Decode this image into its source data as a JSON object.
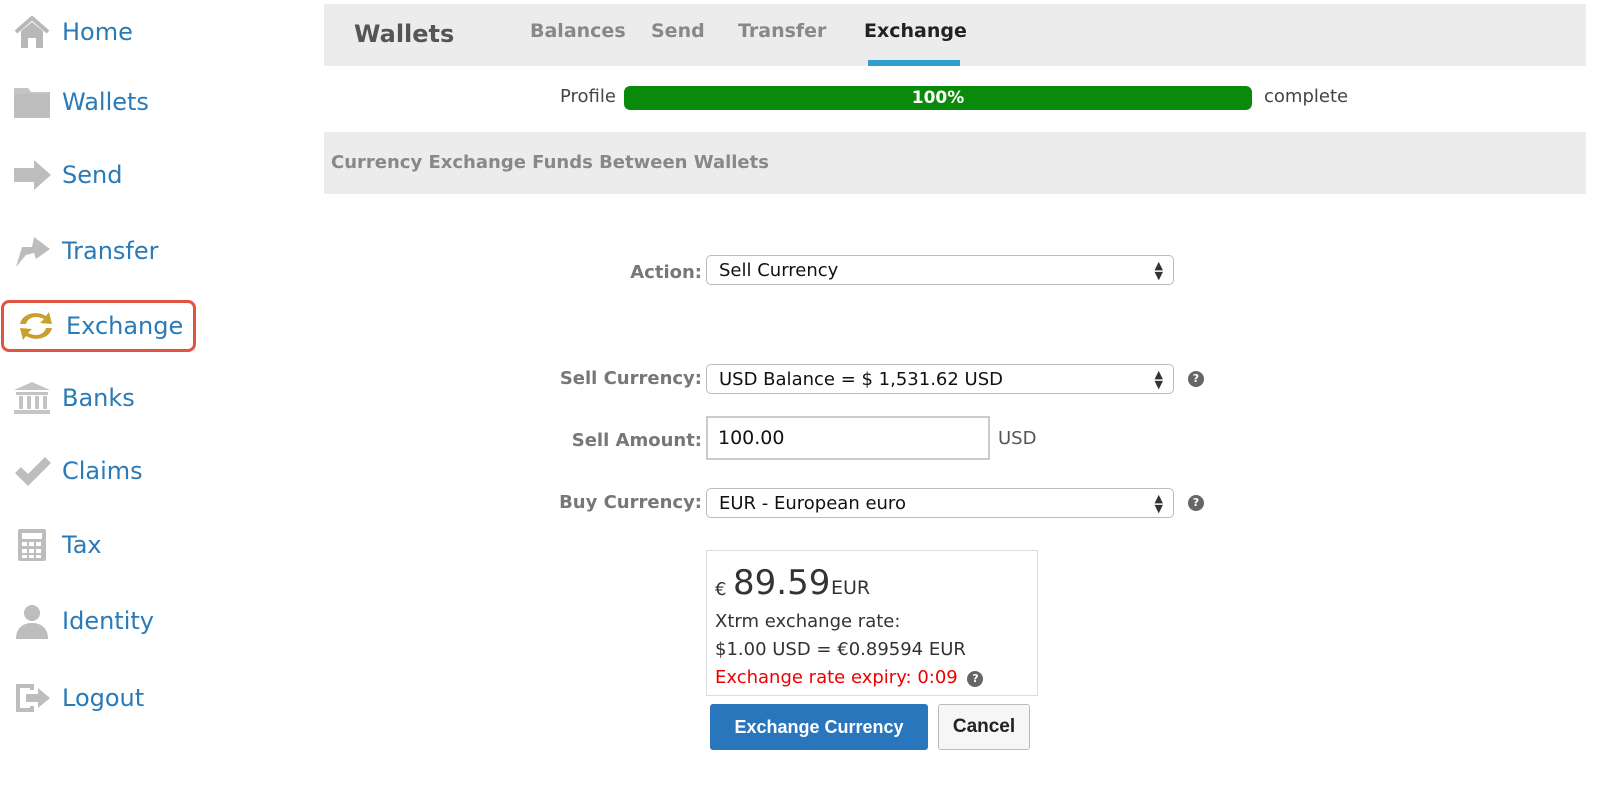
{
  "sidebar": {
    "items": [
      {
        "label": "Home",
        "icon": "home-icon"
      },
      {
        "label": "Wallets",
        "icon": "folder-icon"
      },
      {
        "label": "Send",
        "icon": "arrow-right-icon"
      },
      {
        "label": "Transfer",
        "icon": "arrow-up-right-icon"
      },
      {
        "label": "Exchange",
        "icon": "exchange-icon",
        "active": true
      },
      {
        "label": "Banks",
        "icon": "bank-icon"
      },
      {
        "label": "Claims",
        "icon": "checkmark-icon"
      },
      {
        "label": "Tax",
        "icon": "calculator-icon"
      },
      {
        "label": "Identity",
        "icon": "person-icon"
      },
      {
        "label": "Logout",
        "icon": "logout-icon"
      }
    ]
  },
  "header": {
    "brand": "Wallets",
    "tabs": [
      {
        "label": "Balances"
      },
      {
        "label": "Send"
      },
      {
        "label": "Transfer"
      },
      {
        "label": "Exchange",
        "active": true
      }
    ]
  },
  "progress": {
    "left_label": "Profile",
    "value_text": "100%",
    "value": 1.0,
    "right_label": "complete"
  },
  "section": {
    "title": "Currency Exchange Funds Between Wallets"
  },
  "form": {
    "action_label": "Action:",
    "action_value": "Sell Currency",
    "sell_currency_label": "Sell Currency:",
    "sell_currency_value": "USD Balance = $ 1,531.62 USD",
    "sell_amount_label": "Sell Amount:",
    "sell_amount_value": "100.00",
    "sell_amount_unit": "USD",
    "buy_currency_label": "Buy Currency:",
    "buy_currency_value": "EUR - European euro"
  },
  "result": {
    "symbol": "€",
    "amount": "89.59",
    "currency": "EUR",
    "rate_label": "Xtrm exchange rate:",
    "rate_value": "$1.00 USD = €0.89594 EUR",
    "expiry": "Exchange rate expiry: 0:09"
  },
  "buttons": {
    "primary": "Exchange Currency",
    "secondary": "Cancel"
  },
  "colors": {
    "link": "#2a7ab8",
    "active_border": "#e05442",
    "progress": "#0a8a0a",
    "primary": "#2a76bd",
    "expiry": "#e00000",
    "icon_gold": "#c9a02c",
    "icon_gray": "#b8b8b8"
  }
}
